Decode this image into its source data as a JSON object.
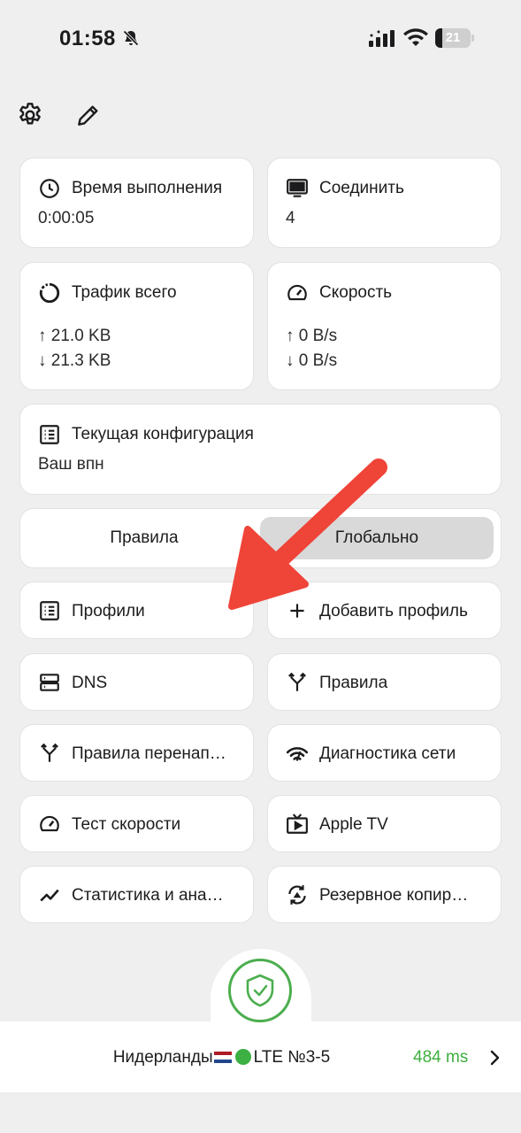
{
  "status_bar": {
    "time": "01:58",
    "battery": "21",
    "battery_level": 0.21
  },
  "stats": {
    "runtime": {
      "title": "Время выполнения",
      "value": "0:00:05"
    },
    "connections": {
      "title": "Соединить",
      "value": "4"
    },
    "traffic": {
      "title": "Трафик всего",
      "up": "↑ 21.0 KB",
      "down": "↓ 21.3 KB"
    },
    "speed": {
      "title": "Скорость",
      "up": "↑ 0 B/s",
      "down": "↓ 0 B/s"
    },
    "config": {
      "title": "Текущая конфигурация",
      "value": "Ваш впн"
    }
  },
  "mode": {
    "rules": "Правила",
    "global": "Глобально",
    "selected": "global"
  },
  "menu": {
    "profiles": "Профили",
    "add_profile": "Добавить профиль",
    "dns": "DNS",
    "rules": "Правила",
    "rewrite_rules": "Правила перенаправления",
    "diagnostics": "Диагностика сети",
    "speed_test": "Тест скорости",
    "apple_tv": "Apple TV",
    "statistics": "Статистика и анализ",
    "backup": "Резервное копирование"
  },
  "server": {
    "name": "Нидерланды",
    "suffix": "LTE №3-5",
    "ping": "484 ms"
  },
  "colors": {
    "accent_green": "#4cae4f",
    "arrow_red": "#ef4438"
  }
}
